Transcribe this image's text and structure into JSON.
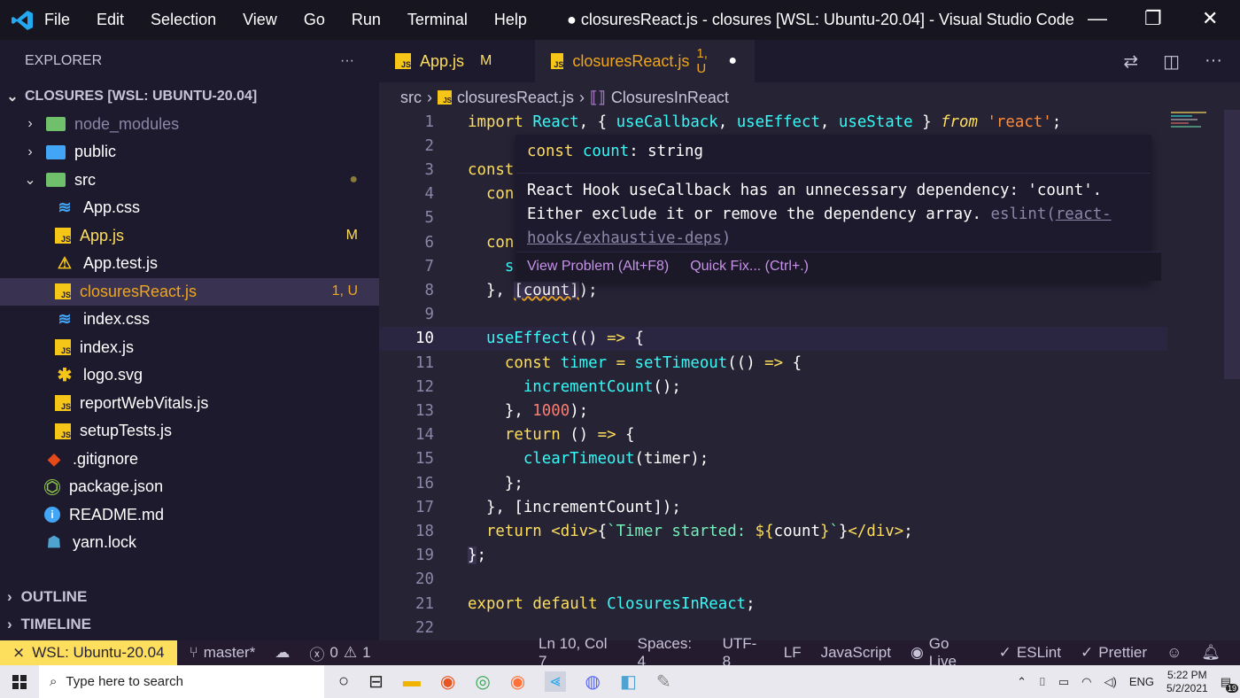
{
  "window": {
    "title": "● closuresReact.js - closures [WSL: Ubuntu-20.04] - Visual Studio Code",
    "menu": [
      "File",
      "Edit",
      "Selection",
      "View",
      "Go",
      "Run",
      "Terminal",
      "Help"
    ]
  },
  "sidebar": {
    "header": "EXPLORER",
    "more": "···",
    "root": "CLOSURES [WSL: UBUNTU-20.04]",
    "items": [
      {
        "label": "node_modules",
        "type": "folder",
        "state": "collapsed",
        "color": "#6fbf6b"
      },
      {
        "label": "public",
        "type": "folder",
        "state": "collapsed",
        "color": "#42a5f5"
      },
      {
        "label": "src",
        "type": "folder",
        "state": "expanded",
        "color": "#6fbf6b",
        "badge": "●"
      },
      {
        "label": "App.css",
        "type": "css-file"
      },
      {
        "label": "App.js",
        "type": "js-file",
        "badge": "M",
        "color": "#fede5d"
      },
      {
        "label": "App.test.js",
        "type": "test-file"
      },
      {
        "label": "closuresReact.js",
        "type": "js-file",
        "badge": "1, U",
        "color": "#f0a61a"
      },
      {
        "label": "index.css",
        "type": "css-file"
      },
      {
        "label": "index.js",
        "type": "js-file"
      },
      {
        "label": "logo.svg",
        "type": "svg-file"
      },
      {
        "label": "reportWebVitals.js",
        "type": "js-file"
      },
      {
        "label": "setupTests.js",
        "type": "js-file"
      },
      {
        "label": ".gitignore",
        "type": "git-file"
      },
      {
        "label": "package.json",
        "type": "node-file"
      },
      {
        "label": "README.md",
        "type": "info-file"
      },
      {
        "label": "yarn.lock",
        "type": "yarn-file"
      }
    ],
    "outline": "OUTLINE",
    "timeline": "TIMELINE"
  },
  "tabs": [
    {
      "label": "App.js",
      "badge": "M"
    },
    {
      "label": "closuresReact.js",
      "badge": "1, U",
      "dirty": "●"
    }
  ],
  "breadcrumb": [
    "src",
    "closuresReact.js",
    "ClosuresInReact"
  ],
  "hover": {
    "signature": "const count: string",
    "message_1": "React Hook useCallback has an unnecessary dependency: 'count'.",
    "message_2": "Either exclude it or remove the dependency array. ",
    "source_a": "eslint(",
    "source_link_1": "react-",
    "source_link_2": "hooks/exhaustive-deps",
    "source_close": ")",
    "view_problem": "View Problem (Alt+F8)",
    "quick_fix": "Quick Fix... (Ctrl+.)"
  },
  "code": {
    "line_numbers": [
      "1",
      "2",
      "3",
      "4",
      "5",
      "6",
      "7",
      "8",
      "9",
      "10",
      "11",
      "12",
      "13",
      "14",
      "15",
      "16",
      "17",
      "18",
      "19",
      "20",
      "21",
      "22"
    ],
    "current_line": 10
  },
  "status": {
    "remote": "WSL: Ubuntu-20.04",
    "branch": "master*",
    "errors": "0",
    "warnings": "1",
    "position": "Ln 10, Col 7",
    "spaces": "Spaces: 4",
    "encoding": "UTF-8",
    "eol": "LF",
    "language": "JavaScript",
    "golive": "Go Live",
    "eslint": "ESLint",
    "prettier": "Prettier"
  },
  "taskbar": {
    "search_placeholder": "Type here to search",
    "lang": "ENG",
    "time": "5:22 PM",
    "date": "5/2/2021",
    "notifications": "19"
  },
  "colors": {
    "keyword": "#fede5d",
    "function": "#36f9f6",
    "string": "#ff8b39",
    "number": "#f97e72",
    "template": "#72f1b8",
    "status_remote_bg": "#fede5d"
  }
}
